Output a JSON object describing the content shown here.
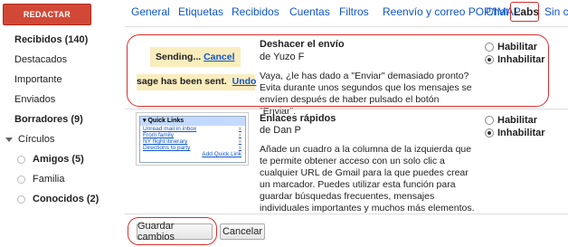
{
  "sidebar": {
    "compose_label": "REDACTAR",
    "items": [
      {
        "label": "Recibidos (140)"
      },
      {
        "label": "Destacados"
      },
      {
        "label": "Importante"
      },
      {
        "label": "Enviados"
      },
      {
        "label": "Borradores (9)"
      }
    ],
    "circles_label": "Círculos",
    "circles": [
      {
        "label": "Amigos (5)"
      },
      {
        "label": "Familia"
      },
      {
        "label": "Conocidos (2)"
      }
    ]
  },
  "tabs": [
    {
      "label": "General"
    },
    {
      "label": "Etiquetas"
    },
    {
      "label": "Recibidos"
    },
    {
      "label": "Cuentas"
    },
    {
      "label": "Filtros"
    },
    {
      "label": "Reenvío y correo POP/IMAP"
    },
    {
      "label": "Chat"
    },
    {
      "label": "Labs"
    },
    {
      "label": "Sin co"
    }
  ],
  "labs": [
    {
      "title": "Deshacer el envío",
      "author": "de Yuzo F",
      "description": "Vaya, ¿le has dado a \"Enviar\" demasiado pronto? Evita durante unos segundos que los mensajes se envíen después de haber pulsado el botón \"Enviar\".",
      "preview": {
        "line1_text": "Sending...",
        "line1_link": "Cancel",
        "line2_text": "sage has been sent.",
        "line2_link": "Undo"
      },
      "options": {
        "enable": "Habilitar",
        "disable": "Inhabilitar",
        "selected": "disable"
      }
    },
    {
      "title": "Enlaces rápidos",
      "author": "de Dan P",
      "description": "Añade un cuadro a la columna de la izquierda que te permite obtener acceso con un solo clic a cualquier URL de Gmail para la que puedes crear un marcador. Puedes utilizar esta función para guardar búsquedas frecuentes, mensajes individuales importantes y muchos más elementos.",
      "preview": {
        "header": "Quick Links",
        "links": [
          "Unread mail in inbox",
          "From family",
          "NY flight itinerary",
          "Directions to party"
        ],
        "add_link": "Add Quick Link"
      },
      "options": {
        "enable": "Habilitar",
        "disable": "Inhabilitar",
        "selected": "disable"
      }
    }
  ],
  "footer": {
    "save_label": "Guardar cambios",
    "cancel_label": "Cancelar"
  },
  "colors": {
    "compose": "#d14836",
    "link": "#1155cc",
    "annotation": "#d43030",
    "preview_highlight": "#f9edbe"
  }
}
